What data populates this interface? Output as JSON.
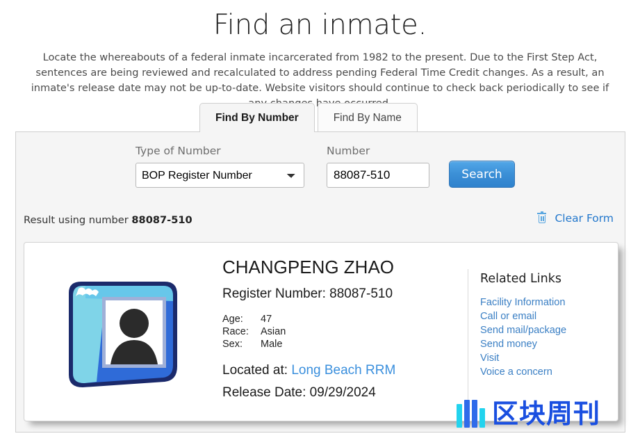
{
  "header": {
    "title": "Find an inmate.",
    "intro": "Locate the whereabouts of a federal inmate incarcerated from 1982 to the present. Due to the First Step Act, sentences are being reviewed and recalculated to address pending Federal Time Credit changes. As a result, an inmate's release date may not be up-to-date. Website visitors should continue to check back periodically to see if any changes have occurred."
  },
  "tabs": [
    {
      "label": "Find By Number",
      "active": true
    },
    {
      "label": "Find By Name",
      "active": false
    }
  ],
  "form": {
    "type_label": "Type of Number",
    "type_value": "BOP Register Number",
    "type_options": [
      "BOP Register Number"
    ],
    "number_label": "Number",
    "number_value": "88087-510",
    "number_placeholder": "",
    "search_label": "Search"
  },
  "result_bar": {
    "prefix": "Result using number",
    "number": "88087-510",
    "clear_label": "Clear Form",
    "trash_icon": "trash-icon"
  },
  "inmate": {
    "name": "CHANGPENG ZHAO",
    "register_number_line": "Register Number: 88087-510",
    "attributes": [
      {
        "key": "Age:",
        "value": "47"
      },
      {
        "key": "Race:",
        "value": "Asian"
      },
      {
        "key": "Sex:",
        "value": "Male"
      }
    ],
    "located_label": "Located at:",
    "located_value": "Long Beach RRM",
    "release_line": "Release Date: 09/29/2024",
    "avatar_icon": "user-photo-frame-icon"
  },
  "related_links": {
    "title": "Related Links",
    "items": [
      "Facility Information",
      "Call or email",
      "Send mail/package",
      "Send money",
      "Visit",
      "Voice a concern"
    ]
  },
  "watermark": {
    "text": "区块周刊",
    "bars": [
      "#22d3ee",
      "#2f6bea",
      "#2f6bea",
      "#22d3ee"
    ]
  },
  "colors": {
    "link": "#3a7fc4",
    "button": "#3b8fd6",
    "panel_bg": "#f5f5f5",
    "accent_blue": "#2277cc"
  }
}
